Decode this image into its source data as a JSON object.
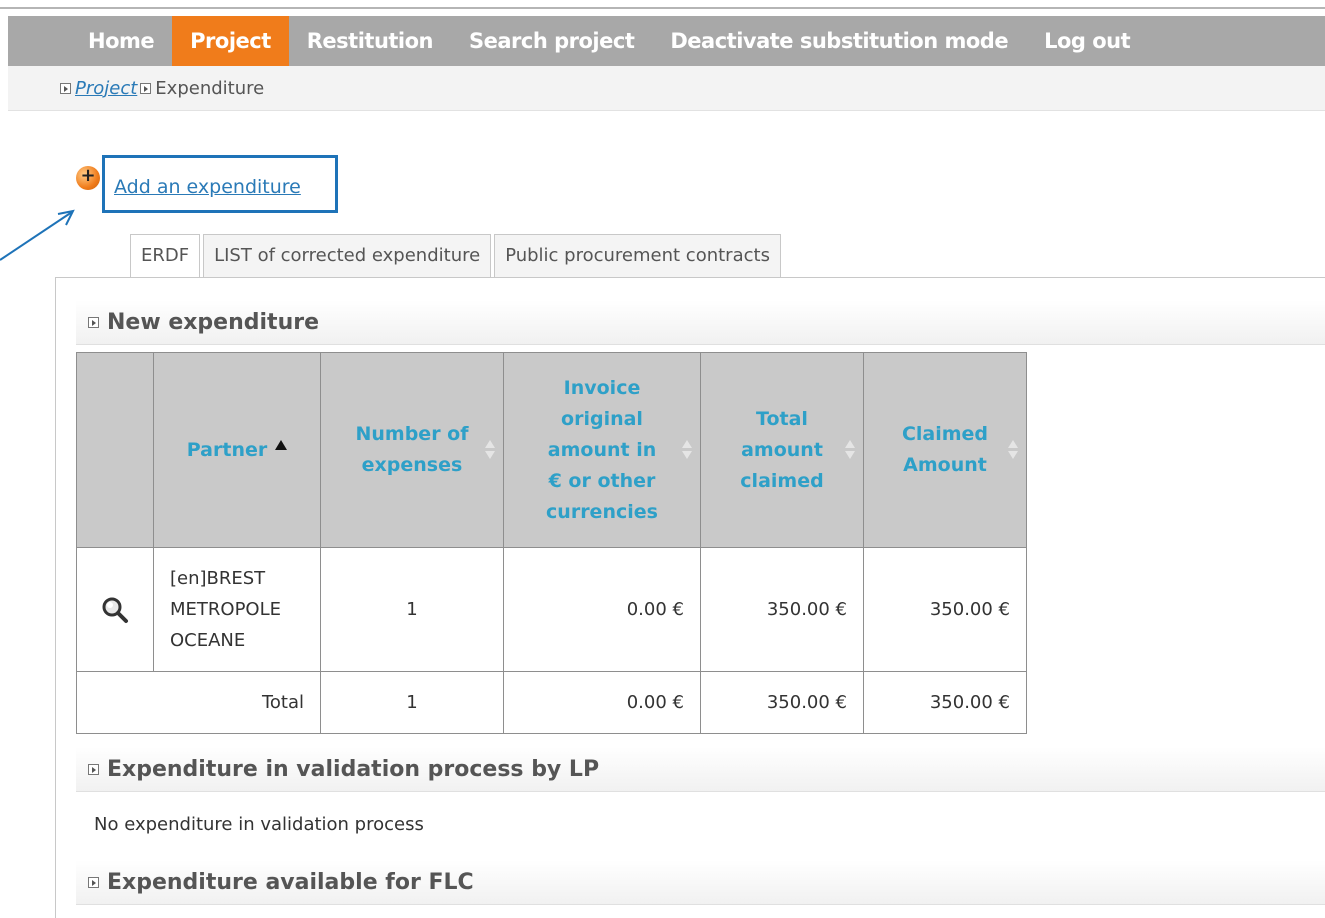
{
  "nav": {
    "items": [
      {
        "label": "Home",
        "active": false
      },
      {
        "label": "Project",
        "active": true
      },
      {
        "label": "Restitution",
        "active": false
      },
      {
        "label": "Search project",
        "active": false
      },
      {
        "label": "Deactivate substitution mode",
        "active": false
      },
      {
        "label": "Log out",
        "active": false
      }
    ]
  },
  "breadcrumb": {
    "link": "Project",
    "current": "Expenditure"
  },
  "add_link": "Add an expenditure",
  "tabs": [
    "ERDF",
    "LIST of corrected expenditure",
    "Public procurement contracts"
  ],
  "sections": {
    "new_expenditure": "New expenditure",
    "validation": "Expenditure in validation process by LP",
    "no_validation": "No expenditure in validation process",
    "flc": "Expenditure available for FLC"
  },
  "table": {
    "headers": {
      "partner": "Partner",
      "number": "Number of expenses",
      "invoice": "Invoice original amount in € or other currencies",
      "total_claimed": "Total amount claimed",
      "claimed": "Claimed Amount"
    },
    "rows": [
      {
        "partner": "[en]BREST METROPOLE OCEANE",
        "number": "1",
        "invoice": "0.00 €",
        "total_claimed": "350.00 €",
        "claimed": "350.00 €"
      }
    ],
    "total": {
      "label": "Total",
      "number": "1",
      "invoice": "0.00 €",
      "total_claimed": "350.00 €",
      "claimed": "350.00 €"
    }
  },
  "colors": {
    "nav_bg": "#a8a8a8",
    "nav_active": "#f07c1b",
    "header_text": "#2ea0c8",
    "link": "#2a7ab7",
    "highlight_box": "#1e73b8"
  }
}
